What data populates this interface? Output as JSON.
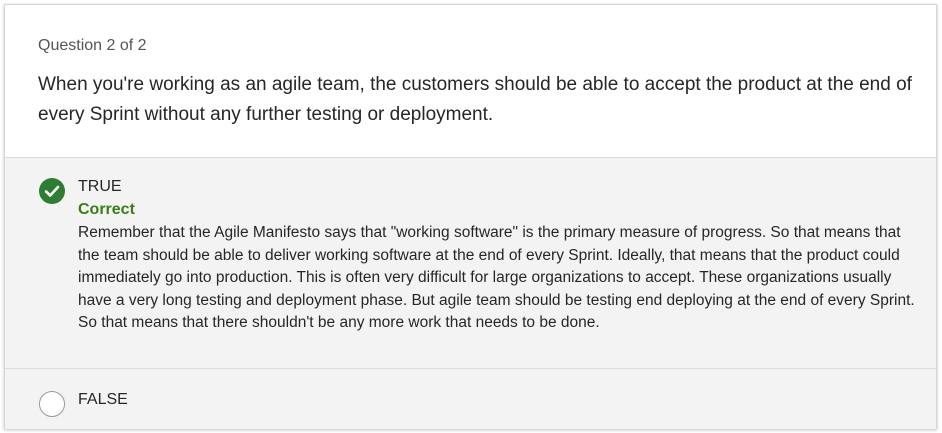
{
  "question": {
    "counter": "Question 2 of 2",
    "text": "When you're working as an agile team, the customers should be able to accept the product at the end of every Sprint without any further testing or deployment."
  },
  "options": [
    {
      "label": "TRUE",
      "selected": true,
      "verdict": "Correct",
      "explanation": "Remember that the Agile Manifesto says that \"working software\" is the primary measure of progress. So that means that the team should be able to deliver working software at the end of every Sprint. Ideally, that means that the product could immediately go into production. This is often very difficult for large organizations to accept. These organizations usually have a very long testing and deployment phase. But agile team should be testing end deploying at the end of every Sprint. So that means that there shouldn't be any more work that needs to be done."
    },
    {
      "label": "FALSE",
      "selected": false
    }
  ],
  "colors": {
    "correct_green": "#2e7d32",
    "verdict_green": "#3a7d1a",
    "answer_bg": "#f3f3f3"
  },
  "icons": {
    "correct": "check-circle-icon",
    "unselected": "radio-circle-icon"
  }
}
